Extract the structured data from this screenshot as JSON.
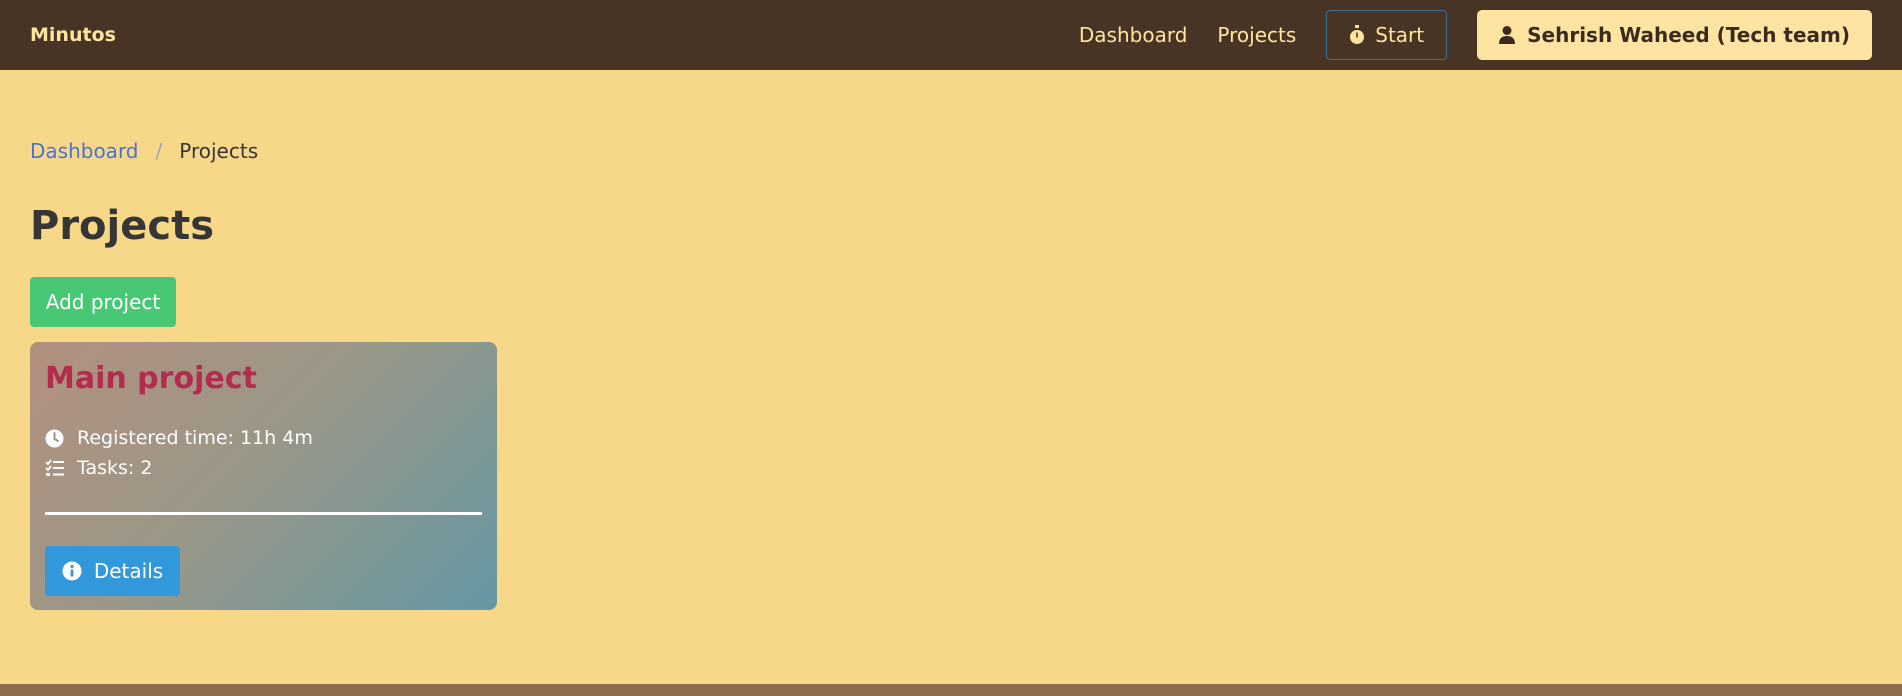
{
  "navbar": {
    "brand": "Minutos",
    "links": [
      {
        "label": "Dashboard"
      },
      {
        "label": "Projects"
      }
    ],
    "start_label": "Start",
    "start_icon": "stopwatch-icon",
    "user_label": "Sehrish Waheed (Tech team)",
    "user_icon": "user-icon"
  },
  "breadcrumb": {
    "items": [
      "Dashboard",
      "Projects"
    ],
    "separator": "/"
  },
  "page": {
    "title": "Projects",
    "add_button_label": "Add project"
  },
  "projects": [
    {
      "name": "Main project",
      "registered_time_label": "Registered time: 11h 4m",
      "tasks_label": "Tasks: 2",
      "details_label": "Details",
      "clock_icon": "clock-icon",
      "tasks_icon": "list-check-icon",
      "info_icon": "info-circle-icon"
    }
  ],
  "colors": {
    "navbar_bg": "#483425",
    "page_bg": "#f7d788",
    "add_button": "#48c774",
    "details_button": "#3298dc",
    "project_title": "#b42c4d"
  }
}
